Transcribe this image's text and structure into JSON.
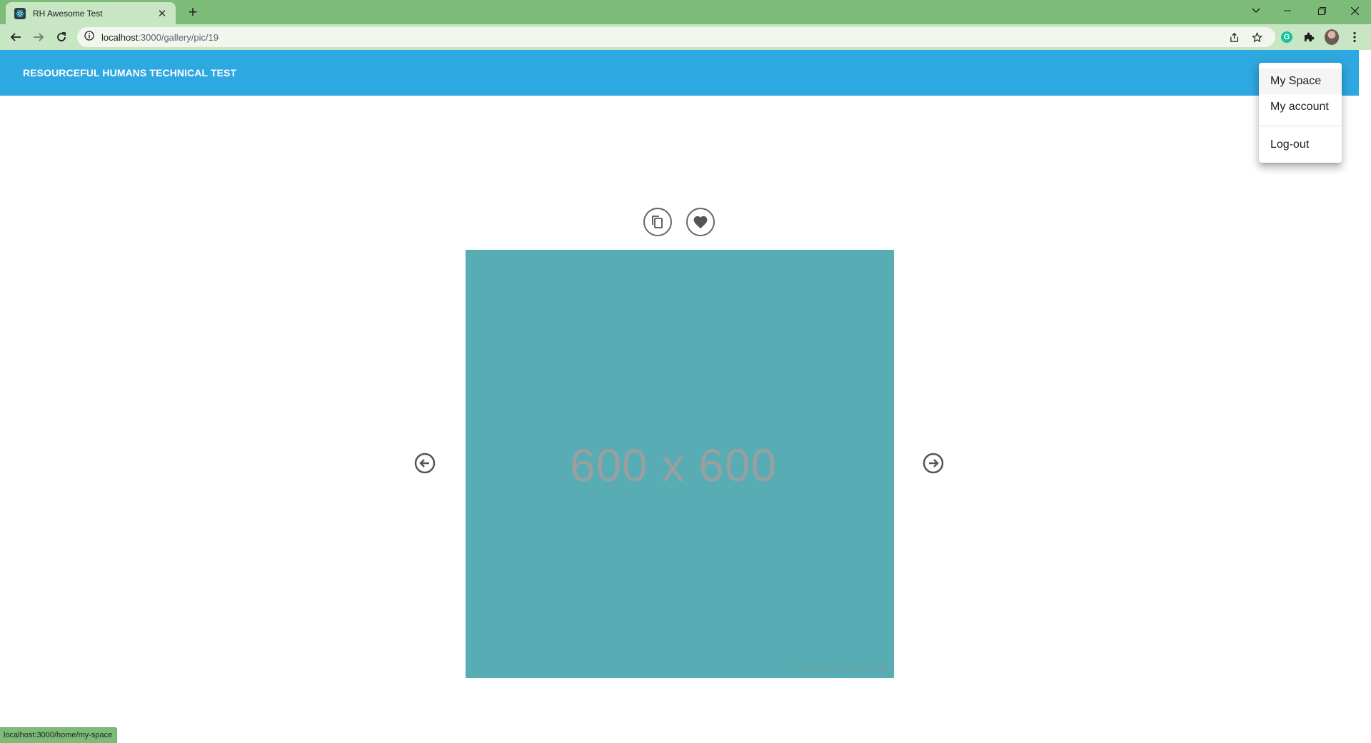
{
  "browser": {
    "tab": {
      "title": "RH Awesome Test"
    },
    "address": {
      "host": "localhost",
      "path": ":3000/gallery/pic/19"
    }
  },
  "app": {
    "title": "RESOURCEFUL HUMANS TECHNICAL TEST",
    "accent_color": "#2ea8e0"
  },
  "user_menu": {
    "items": [
      {
        "label": "My Space"
      },
      {
        "label": "My account"
      },
      {
        "label": "Log-out"
      }
    ]
  },
  "picture": {
    "placeholder_text": "600 x 600",
    "credit": "Powered by HTML.COM",
    "background": "#58acb3"
  },
  "status": {
    "url": "localhost:3000/home/my-space"
  }
}
